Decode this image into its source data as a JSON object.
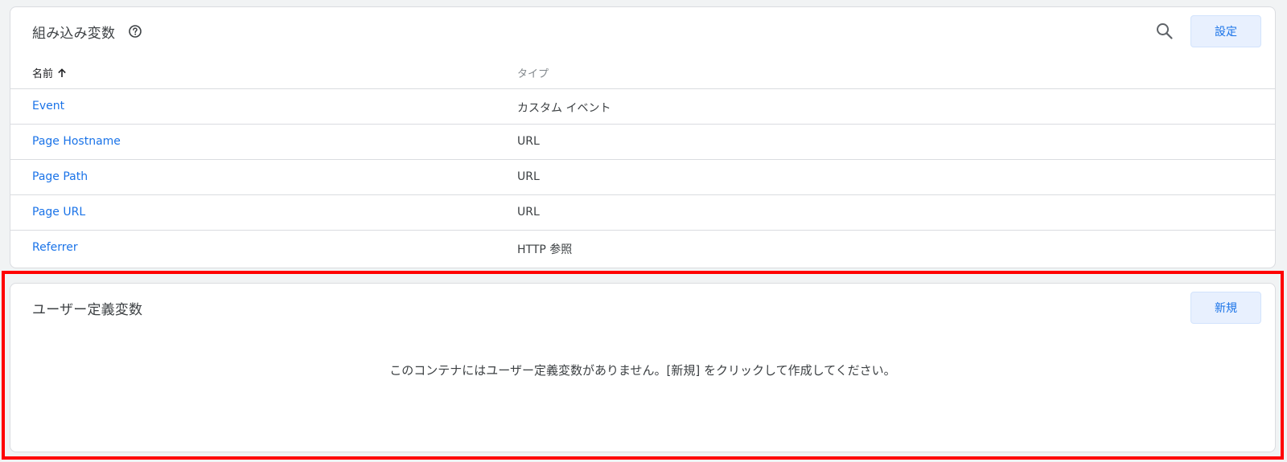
{
  "builtin": {
    "title": "組み込み変数",
    "configure_label": "設定",
    "columns": {
      "name": "名前",
      "type": "タイプ"
    },
    "rows": [
      {
        "name": "Event",
        "type": "カスタム イベント"
      },
      {
        "name": "Page Hostname",
        "type": "URL"
      },
      {
        "name": "Page Path",
        "type": "URL"
      },
      {
        "name": "Page URL",
        "type": "URL"
      },
      {
        "name": "Referrer",
        "type": "HTTP 参照"
      }
    ],
    "icons": {
      "help": "help-circle-icon",
      "search": "search-icon",
      "sort": "arrow-up-icon"
    }
  },
  "user_defined": {
    "title": "ユーザー定義変数",
    "new_label": "新規",
    "empty_message": "このコンテナにはユーザー定義変数がありません。[新規] をクリックして作成してください。"
  },
  "colors": {
    "accent": "#1a73e8",
    "button_bg": "#e8f0fe",
    "highlight": "#ff0000"
  }
}
